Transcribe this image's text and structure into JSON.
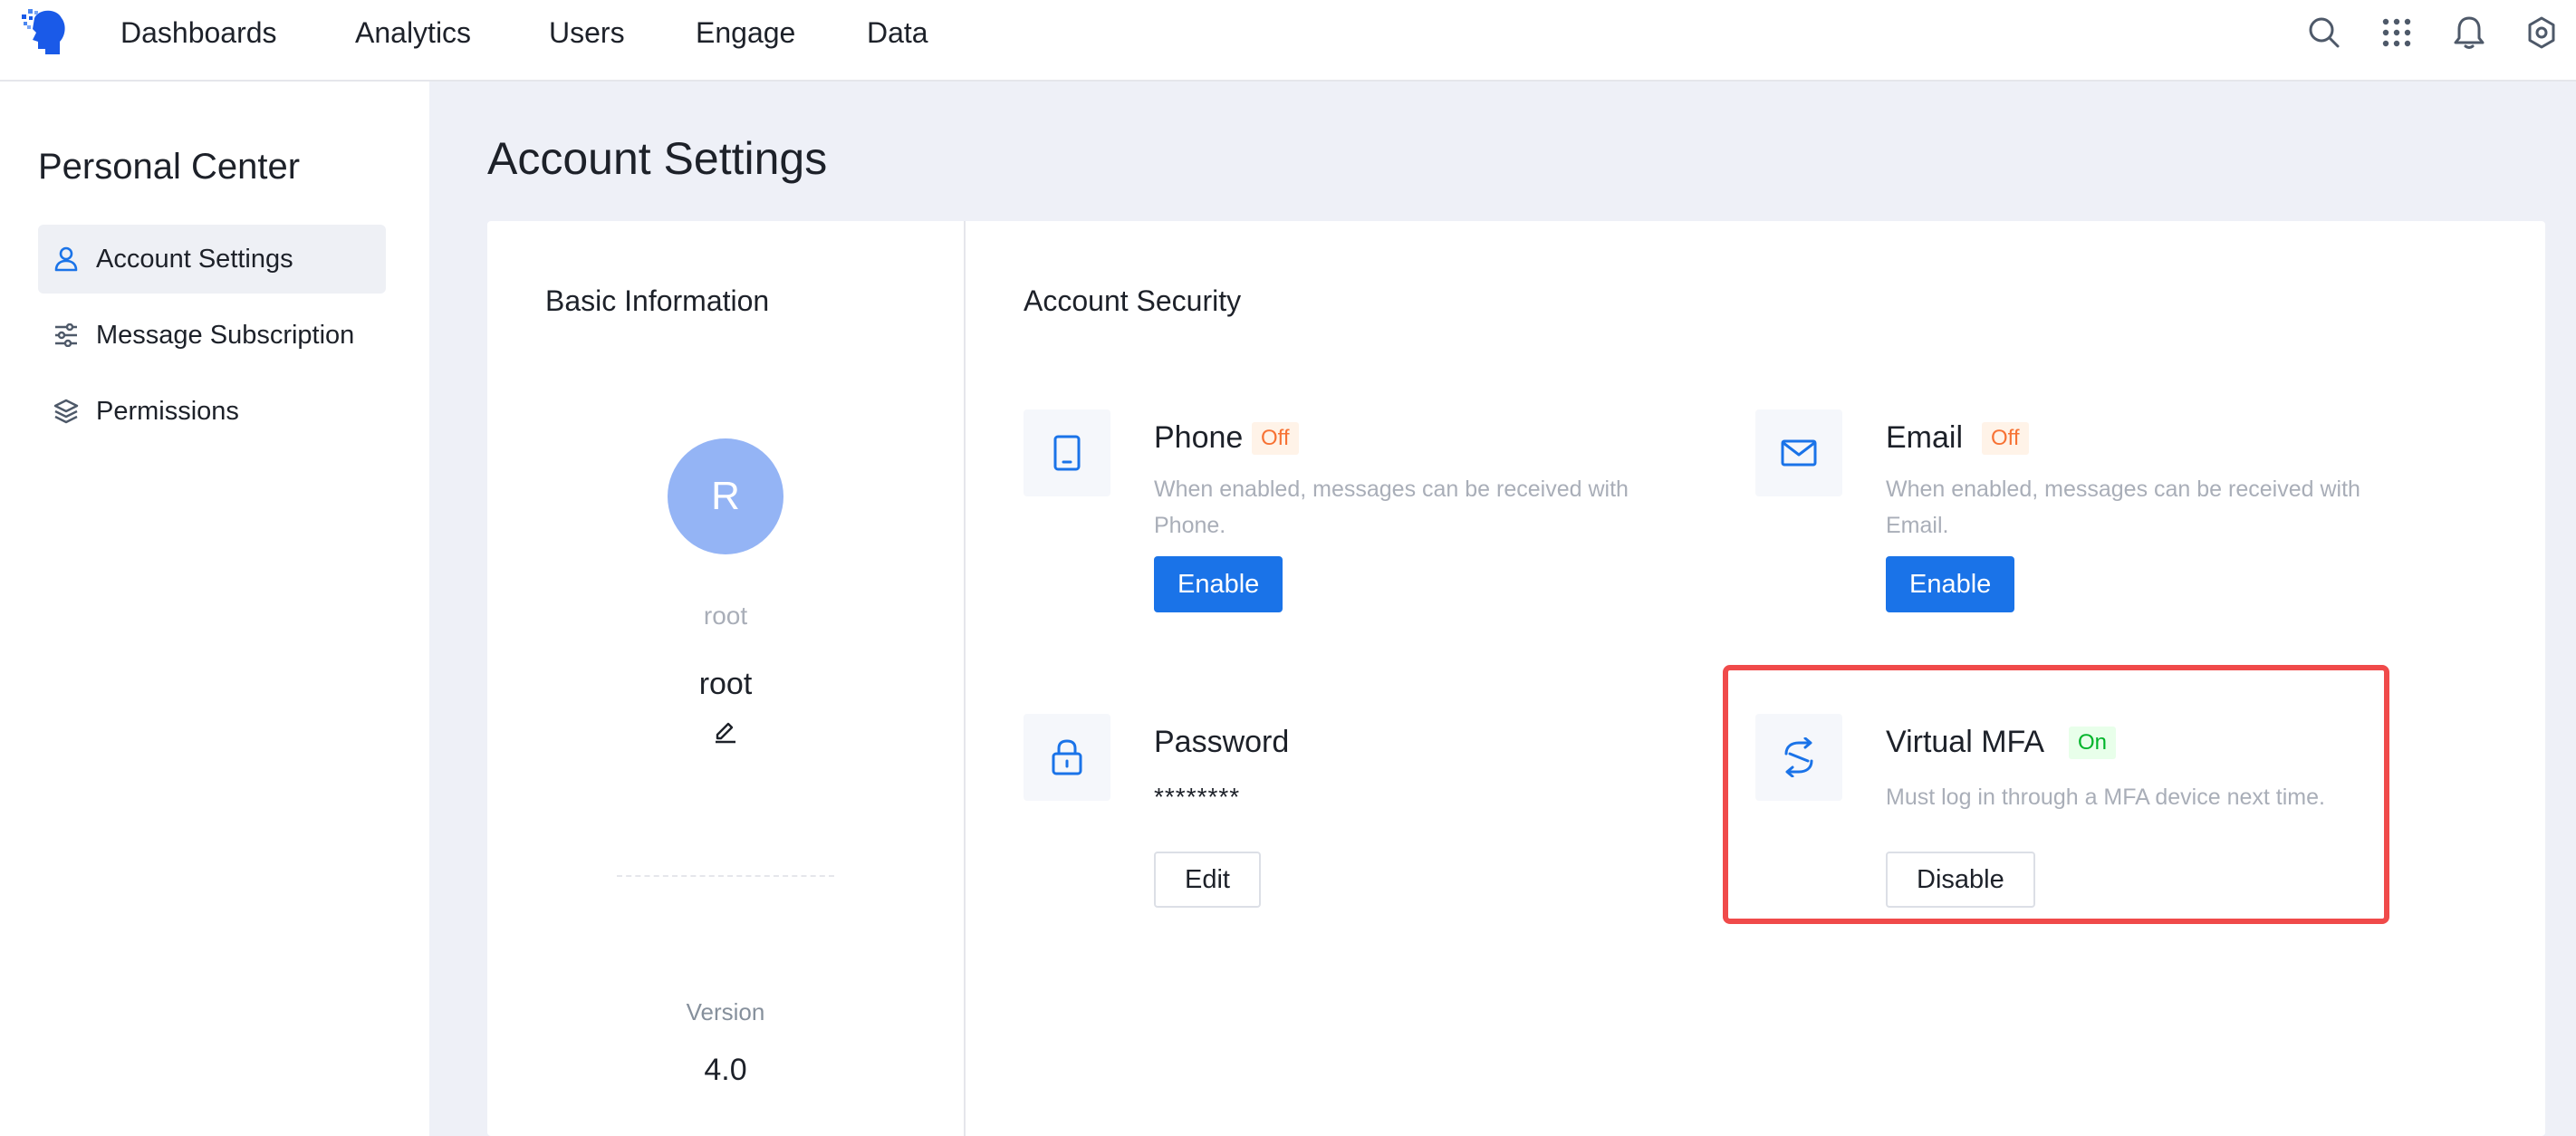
{
  "nav": {
    "items": [
      "Dashboards",
      "Analytics",
      "Users",
      "Engage",
      "Data"
    ]
  },
  "sidebar": {
    "title": "Personal Center",
    "items": [
      {
        "label": "Account Settings",
        "icon": "user-icon",
        "active": true
      },
      {
        "label": "Message Subscription",
        "icon": "sliders-icon",
        "active": false
      },
      {
        "label": "Permissions",
        "icon": "layers-icon",
        "active": false
      }
    ]
  },
  "page": {
    "title": "Account Settings"
  },
  "basic_info": {
    "title": "Basic Information",
    "avatar_letter": "R",
    "username_small": "root",
    "username": "root",
    "version_label": "Version",
    "version_value": "4.0"
  },
  "security": {
    "title": "Account Security",
    "phone": {
      "name": "Phone",
      "status": "Off",
      "description": "When enabled, messages can be received with Phone.",
      "button": "Enable"
    },
    "email": {
      "name": "Email",
      "status": "Off",
      "description": "When enabled, messages can be received with Email.",
      "button": "Enable"
    },
    "password": {
      "name": "Password",
      "masked": "********",
      "button": "Edit"
    },
    "mfa": {
      "name": "Virtual MFA",
      "status": "On",
      "description": "Must log in through a MFA device next time.",
      "button": "Disable"
    }
  },
  "colors": {
    "primary": "#1a73e8",
    "avatar": "#94b4f5",
    "off_tag": "#f77234",
    "on_tag": "#00b42a",
    "highlight": "#f04a4a"
  }
}
